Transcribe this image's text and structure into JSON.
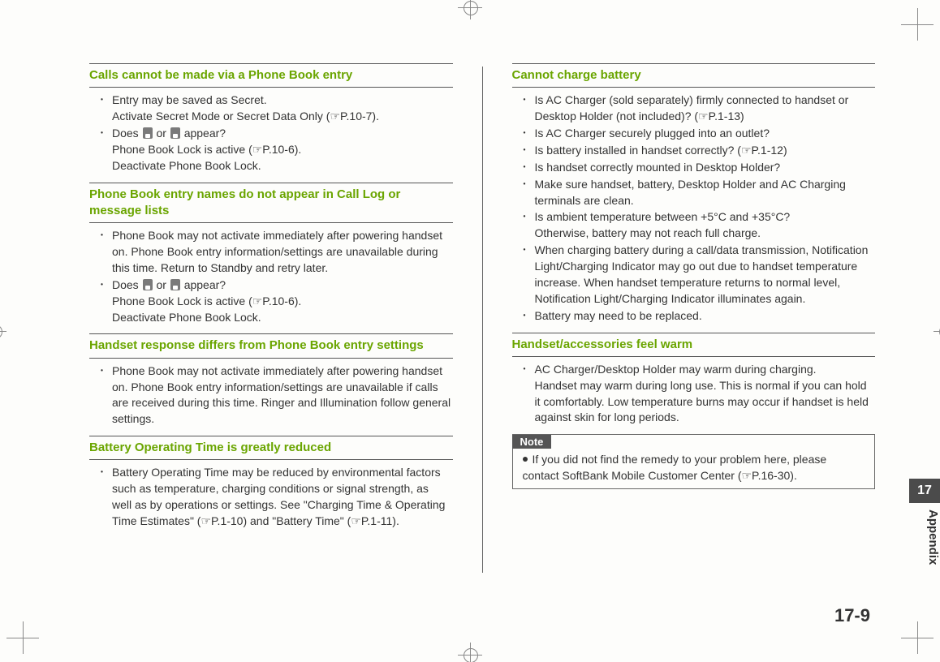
{
  "page": {
    "number": "17-9",
    "tab_chapter": "17",
    "tab_label": "Appendix"
  },
  "left": {
    "sections": [
      {
        "title": "Calls cannot be made via a Phone Book entry",
        "items": [
          {
            "lines": [
              "Entry may be saved as Secret.",
              "Activate Secret Mode or Secret Data Only (☞P.10-7)."
            ]
          },
          {
            "lines": [
              "Does ▮ or ▮ appear?",
              "Phone Book Lock is active (☞P.10-6).",
              "Deactivate Phone Book Lock."
            ],
            "hasIcons": true
          }
        ]
      },
      {
        "title": "Phone Book entry names do not appear in Call Log or message lists",
        "items": [
          {
            "lines": [
              "Phone Book may not activate immediately after powering handset on. Phone Book entry information/settings are unavailable during this time. Return to Standby and retry later."
            ]
          },
          {
            "lines": [
              "Does ▮ or ▮ appear?",
              "Phone Book Lock is active (☞P.10-6).",
              "Deactivate Phone Book Lock."
            ],
            "hasIcons": true
          }
        ]
      },
      {
        "title": "Handset response differs from Phone Book entry settings",
        "items": [
          {
            "lines": [
              "Phone Book may not activate immediately after powering handset on. Phone Book entry information/settings are unavailable if calls are received during this time. Ringer and Illumination follow general settings."
            ]
          }
        ]
      },
      {
        "title": "Battery Operating Time is greatly reduced",
        "items": [
          {
            "lines": [
              "Battery Operating Time may be reduced by environmental factors such as temperature, charging conditions or signal strength, as well as by operations or settings. See \"Charging Time & Operating Time Estimates\" (☞P.1-10) and \"Battery Time\" (☞P.1-11)."
            ]
          }
        ]
      }
    ]
  },
  "right": {
    "sections": [
      {
        "title": "Cannot charge battery",
        "items": [
          {
            "lines": [
              "Is AC Charger (sold separately) firmly connected to handset or Desktop Holder (not included)? (☞P.1-13)"
            ]
          },
          {
            "lines": [
              "Is AC Charger securely plugged into an outlet?"
            ]
          },
          {
            "lines": [
              "Is battery installed in handset correctly? (☞P.1-12)"
            ]
          },
          {
            "lines": [
              "Is handset correctly mounted in Desktop Holder?"
            ]
          },
          {
            "lines": [
              "Make sure handset, battery, Desktop Holder and AC Charging terminals are clean."
            ]
          },
          {
            "lines": [
              "Is ambient temperature between +5°C and +35°C?",
              "Otherwise, battery may not reach full charge."
            ]
          },
          {
            "lines": [
              "When charging battery during a call/data transmission, Notification Light/Charging Indicator may go out due to handset temperature increase. When handset temperature returns to normal level, Notification Light/Charging Indicator illuminates again."
            ]
          },
          {
            "lines": [
              "Battery may need to be replaced."
            ]
          }
        ]
      },
      {
        "title": "Handset/accessories feel warm",
        "items": [
          {
            "lines": [
              "AC Charger/Desktop Holder may warm during charging.",
              "Handset may warm during long use. This is normal if you can hold it comfortably. Low temperature burns may occur if handset is held against skin for long periods."
            ]
          }
        ]
      }
    ],
    "note": {
      "label": "Note",
      "text": "If you did not find the remedy to your problem here, please contact SoftBank Mobile Customer Center (☞P.16-30)."
    }
  }
}
